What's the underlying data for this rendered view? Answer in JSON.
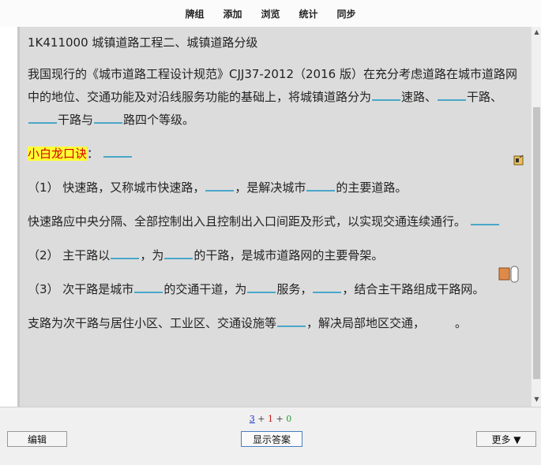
{
  "menu": {
    "decks": "牌组",
    "add": "添加",
    "browse": "浏览",
    "stats": "统计",
    "sync": "同步"
  },
  "card": {
    "title": "1K411000  城镇道路工程二、城镇道路分级",
    "para1_a": "我国现行的《城市道路工程设计规范》CJJ37-2012（2016 版）在充分考虑道路在城市道路网中的地位、交通功能及对沿线服务功能的基础上，将城镇道路分为",
    "para1_b": "速路、",
    "para1_c": "干路、",
    "para1_d": "干路与",
    "para1_e": "路四个等级。",
    "mnemonic_label": "小白龙口诀",
    "mnemonic_colon": "：",
    "item1_a": "（1） 快速路，又称城市快速路，",
    "item1_b": "，是解决城市",
    "item1_c": "的主要道路。",
    "para2_a": "快速路应中央分隔、全部控制出入且控制出入口间距及形式，以实现交通连续通行。",
    "item2_a": "（2） 主干路以",
    "item2_b": "，为",
    "item2_c": "的干路，是城市道路网的主要骨架。",
    "item3_a": "（3） 次干路是城市",
    "item3_b": "的交通干道，为",
    "item3_c": "服务，",
    "item3_d": "，结合主干路组成干路网。",
    "para3_a": "支路为次干路与居住小区、工业区、交通设施等",
    "para3_b": "，解决局部地区交通，",
    "para3_c": "。"
  },
  "counts": {
    "new": "3",
    "plus1": "+",
    "learn": "1",
    "plus2": "+",
    "review": "0"
  },
  "buttons": {
    "edit": "编辑",
    "show_answer": "显示答案",
    "more": "更多 ▼"
  },
  "colors": {
    "highlight_bg": "#ffff33",
    "highlight_text": "#d40000",
    "cloze_underline": "#4aa7c9",
    "new_count": "#1a2ccb",
    "learn_count": "#c21a1a",
    "review_count": "#2a9a2a"
  },
  "icons": {
    "side_top": "audio-clip-icon",
    "side_mid": "toggle-icon"
  }
}
